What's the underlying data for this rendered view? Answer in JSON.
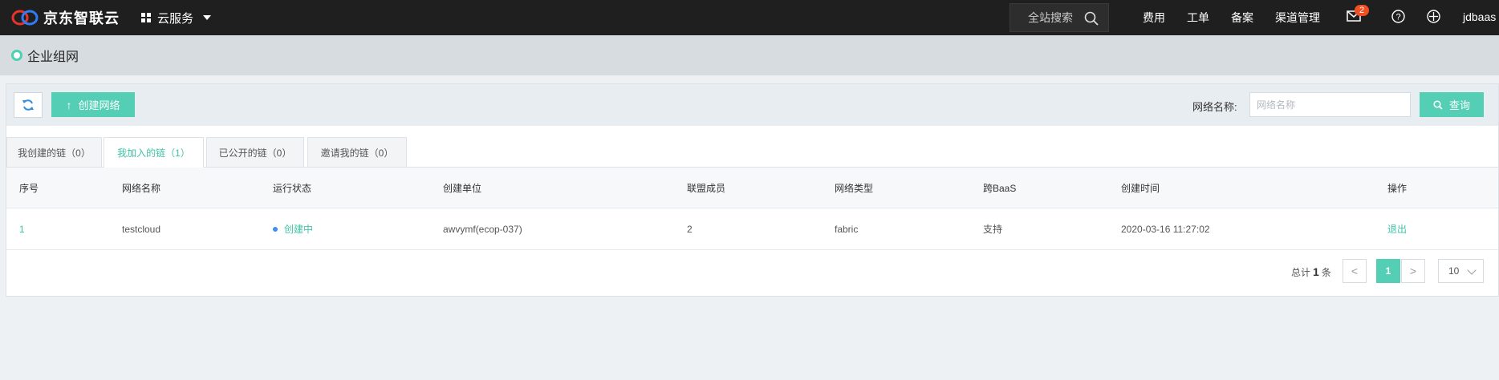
{
  "topbar": {
    "brand": "京东智联云",
    "service_menu": "云服务",
    "search_placeholder": "全站搜索",
    "links": [
      "费用",
      "工单",
      "备案",
      "渠道管理"
    ],
    "mail_badge": "2",
    "user": "jdbaas",
    "colors": {
      "bg": "#1f1f1f",
      "badge": "#f04e23"
    }
  },
  "page": {
    "title": "企业组网"
  },
  "toolbar": {
    "create_label": "创建网络",
    "filter_label": "网络名称:",
    "filter_placeholder": "网络名称",
    "filter_value": "",
    "query_label": "查询"
  },
  "tabs": [
    {
      "label": "我创建的链（0）",
      "active": false
    },
    {
      "label": "我加入的链（1）",
      "active": true
    },
    {
      "label": "已公开的链（0）",
      "active": false
    },
    {
      "label": "邀请我的链（0）",
      "active": false
    }
  ],
  "table": {
    "headers": [
      "序号",
      "网络名称",
      "运行状态",
      "创建单位",
      "联盟成员",
      "网络类型",
      "跨BaaS",
      "创建时间",
      "操作"
    ],
    "rows": [
      {
        "index": "1",
        "name": "testcloud",
        "status": "创建中",
        "org": "awvymf(ecop-037)",
        "members": "2",
        "type": "fabric",
        "cross_baas": "支持",
        "created": "2020-03-16 11:27:02",
        "action": "退出"
      }
    ]
  },
  "pagination": {
    "total_prefix": "总计",
    "total": "1",
    "total_suffix": "条",
    "prev": "<",
    "current": "1",
    "next": ">",
    "page_size": "10"
  },
  "accent_color": "#54cfb5"
}
